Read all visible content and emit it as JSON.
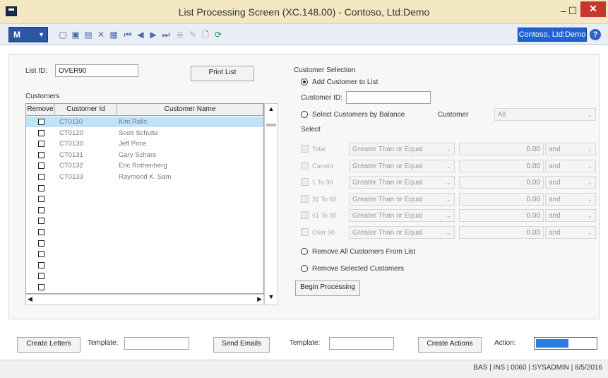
{
  "window": {
    "title": "List Processing Screen (XC.148.00) - Contoso, Ltd:Demo"
  },
  "toolbar": {
    "menu_label": "M",
    "company": "Contoso, Ltd:Demo"
  },
  "list": {
    "id_label": "List ID:",
    "id_value": "OVER90",
    "print_label": "Print List"
  },
  "customers": {
    "group_label": "Customers",
    "columns": [
      "Remove",
      "Customer Id",
      "Customer Name"
    ],
    "rows": [
      {
        "id": "CT0110",
        "name": "Kim Ralls"
      },
      {
        "id": "CT0120",
        "name": "Scott Schulte"
      },
      {
        "id": "CT0130",
        "name": "Jeff Price"
      },
      {
        "id": "CT0131",
        "name": "Gary Schare"
      },
      {
        "id": "CT0132",
        "name": "Eric Rothenberg"
      },
      {
        "id": "CT0133",
        "name": "Raymond K. Sam"
      }
    ],
    "empty_rows": 10
  },
  "selection": {
    "group_label": "Customer Selection",
    "add_label": "Add Customer to List",
    "customer_id_label": "Customer ID:",
    "balance_label": "Select Customers by Balance",
    "customer_label": "Customer",
    "customer_value": "All",
    "select_label": "Select",
    "rows": [
      {
        "label": "Total",
        "op": "Greater Than or Equal",
        "amount": "0.00",
        "conj": "and"
      },
      {
        "label": "Current",
        "op": "Greater Than or Equal",
        "amount": "0.00",
        "conj": "and"
      },
      {
        "label": "1 To 30",
        "op": "Greater Than or Equal",
        "amount": "0.00",
        "conj": "and"
      },
      {
        "label": "31 To 60",
        "op": "Greater Than or Equal",
        "amount": "0.00",
        "conj": "and"
      },
      {
        "label": "61 To 90",
        "op": "Greater Than or Equal",
        "amount": "0.00",
        "conj": "and"
      },
      {
        "label": "Over 90",
        "op": "Greater Than or Equal",
        "amount": "0.00",
        "conj": "and"
      }
    ],
    "remove_all_label": "Remove All Customers From List",
    "remove_selected_label": "Remove Selected Customers",
    "begin_label": "Begin Processing"
  },
  "bottom": {
    "create_letters": "Create Letters",
    "template_label": "Template:",
    "send_emails": "Send Emails",
    "template2_label": "Template:",
    "create_actions": "Create Actions",
    "action_label": "Action:",
    "action_progress": 0.55
  },
  "status": {
    "text": "BAS  | INS  | 0060  | SYSADMIN  | 8/5/2016"
  },
  "colors": {
    "accent": "#2b56a6",
    "selected_row": "#bfe3f6",
    "titlebar": "#f3e8c2",
    "close": "#c7372f"
  }
}
